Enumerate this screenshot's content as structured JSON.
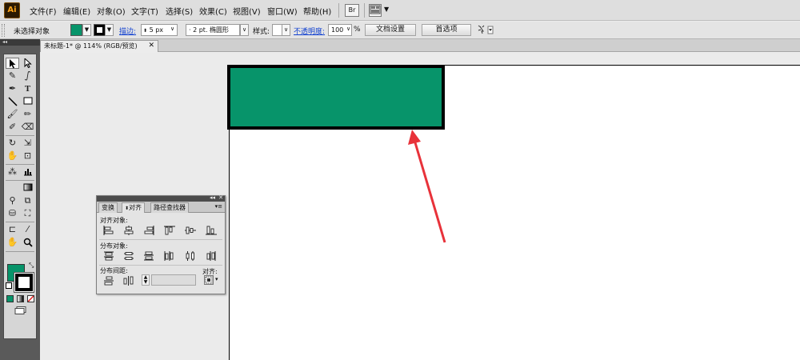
{
  "app": {
    "logo": "Ai"
  },
  "menu": {
    "items": [
      "文件(F)",
      "编辑(E)",
      "对象(O)",
      "文字(T)",
      "选择(S)",
      "效果(C)",
      "视图(V)",
      "窗口(W)",
      "帮助(H)"
    ],
    "bridge_icon": "Br",
    "arrange_icon": "arrange-documents-icon"
  },
  "control_bar": {
    "selection_status": "未选择对象",
    "fill_color": "#07946a",
    "stroke_color": "#000000",
    "stroke_label": "描边:",
    "stroke_weight": "5 px",
    "brush_value": "2 pt. 椭圆形",
    "style_label": "样式:",
    "opacity_label": "不透明度:",
    "opacity_value": "100",
    "opacity_unit": "%",
    "doc_setup_button": "文档设置",
    "preferences_button": "首选项"
  },
  "document": {
    "tab_title": "未标题-1* @ 114% (RGB/预览)",
    "close_glyph": "✕",
    "rect_fill": "#07946a",
    "rect_stroke": "#000000"
  },
  "tools": {
    "fill_color": "#07946a",
    "stroke_color": "#000000",
    "text_tool_glyph": "T"
  },
  "align_panel": {
    "tabs": [
      "变换",
      "对齐",
      "路径查找器"
    ],
    "active_tab": "对齐",
    "section_align_objects": "对齐对象:",
    "section_distribute_objects": "分布对象:",
    "section_distribute_spacing": "分布间距:",
    "align_to_label": "对齐:"
  },
  "annotation": {
    "arrow_color": "#e8323a"
  }
}
